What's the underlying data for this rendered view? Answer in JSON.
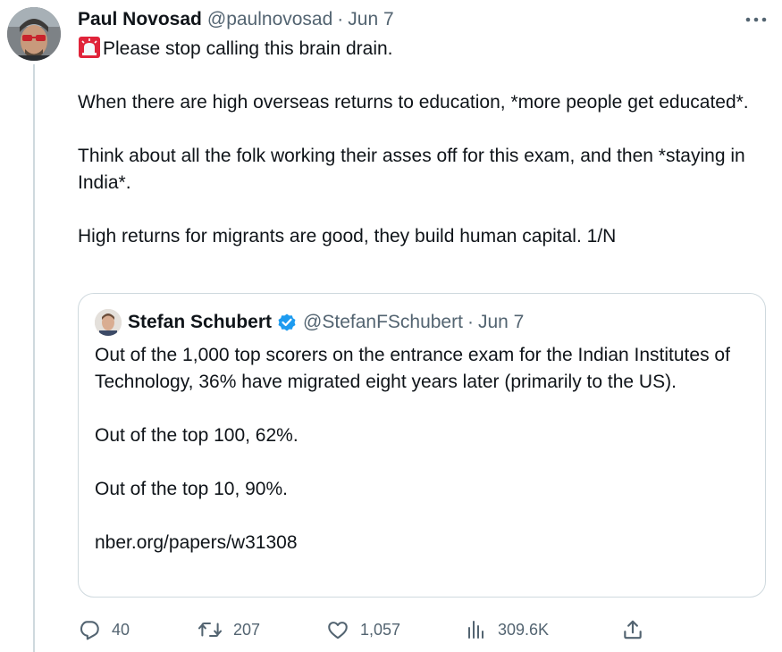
{
  "tweet": {
    "author_name": "Paul Novosad",
    "author_handle": "@paulnovosad",
    "separator": "·",
    "date": "Jun 7",
    "lines": {
      "line1": "Please stop calling this brain drain.",
      "line2": "When there are high overseas returns to education, *more people get educated*.",
      "line3": "Think about all the folk working their asses off for this exam, and then *staying in India*.",
      "line4": "High returns for migrants are good, they build human capital. 1/N"
    },
    "icons": {
      "emoji": "police-car-light-icon",
      "more": "more-options-icon"
    }
  },
  "quote": {
    "author_name": "Stefan Schubert",
    "author_handle": "@StefanFSchubert",
    "separator": "·",
    "date": "Jun 7",
    "verified_icon": "verified-badge-icon",
    "lines": {
      "line1": "Out of the 1,000 top scorers on the entrance exam for the Indian Institutes of Technology, 36% have migrated eight years later (primarily to the US).",
      "line2": "Out of the top 100, 62%.",
      "line3": "Out of the top 10, 90%.",
      "line4": "nber.org/papers/w31308"
    }
  },
  "actions": {
    "reply_count": "40",
    "retweet_count": "207",
    "like_count": "1,057",
    "views_count": "309.6K",
    "icons": [
      "reply-icon",
      "retweet-icon",
      "like-icon",
      "views-icon",
      "share-icon"
    ]
  },
  "colors": {
    "text": "#0f1419",
    "secondary_text": "#536471",
    "border": "#cfd9de",
    "verified_blue": "#1d9bf0",
    "siren_red": "#e0243a"
  }
}
